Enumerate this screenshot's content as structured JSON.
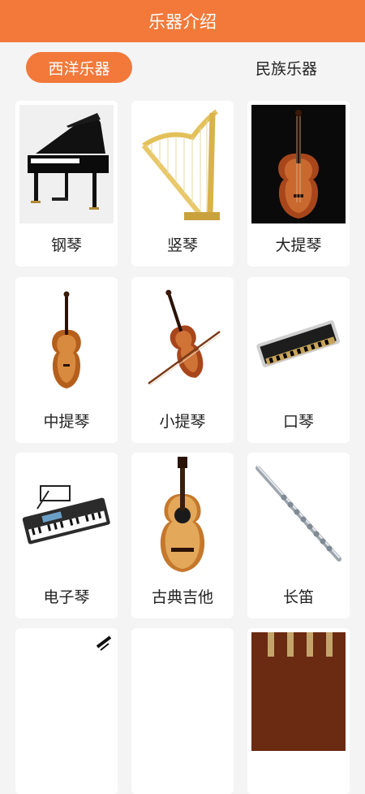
{
  "header": {
    "title": "乐器介绍"
  },
  "tabs": [
    {
      "label": "西洋乐器",
      "active": true
    },
    {
      "label": "民族乐器",
      "active": false
    }
  ],
  "instruments": [
    {
      "name": "钢琴",
      "icon": "piano-icon"
    },
    {
      "name": "竖琴",
      "icon": "harp-icon"
    },
    {
      "name": "大提琴",
      "icon": "cello-icon"
    },
    {
      "name": "中提琴",
      "icon": "viola-icon"
    },
    {
      "name": "小提琴",
      "icon": "violin-icon"
    },
    {
      "name": "口琴",
      "icon": "harmonica-icon"
    },
    {
      "name": "电子琴",
      "icon": "keyboard-icon"
    },
    {
      "name": "古典吉他",
      "icon": "guitar-icon"
    },
    {
      "name": "长笛",
      "icon": "flute-icon"
    }
  ],
  "colors": {
    "accent": "#f2793a",
    "background": "#f4f4f4"
  }
}
